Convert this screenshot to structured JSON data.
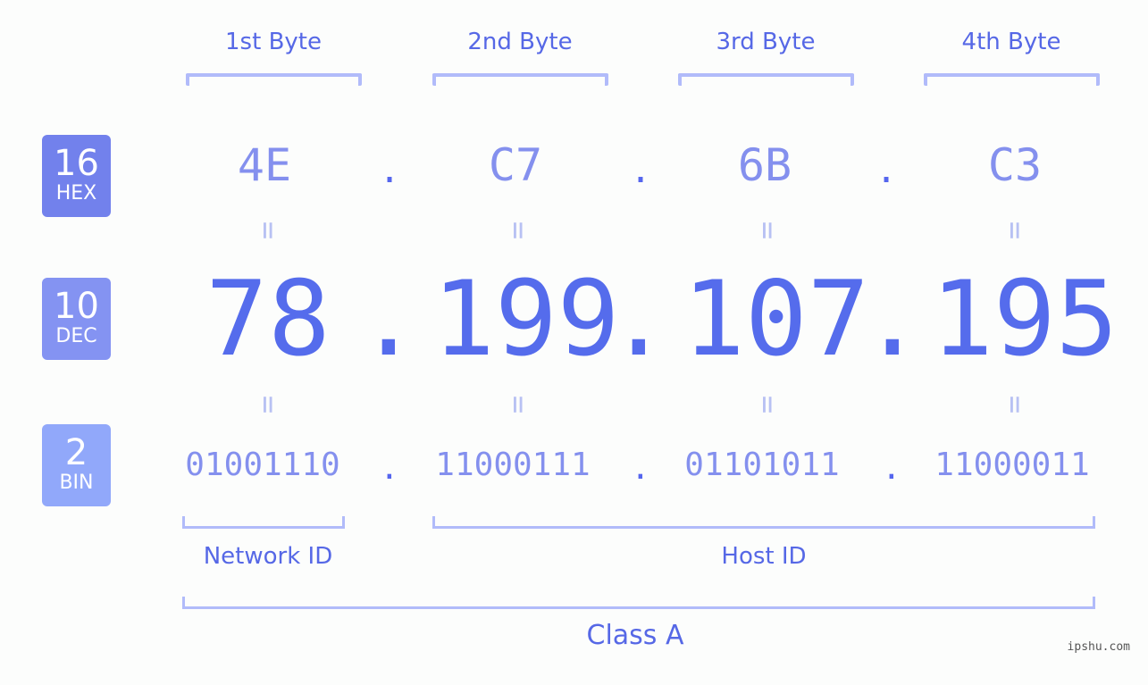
{
  "byte_headers": [
    "1st Byte",
    "2nd Byte",
    "3rd Byte",
    "4th Byte"
  ],
  "badges": {
    "hex": {
      "number": "16",
      "unit": "HEX",
      "color": "#7281ec"
    },
    "dec": {
      "number": "10",
      "unit": "DEC",
      "color": "#8493f2"
    },
    "bin": {
      "number": "2",
      "unit": "BIN",
      "color": "#91a8fa"
    }
  },
  "separator": ".",
  "equals": "=",
  "hex": [
    "4E",
    "C7",
    "6B",
    "C3"
  ],
  "dec": [
    "78",
    "199",
    "107",
    "195"
  ],
  "bin": [
    "01001110",
    "11000111",
    "01101011",
    "11000011"
  ],
  "network_id_label": "Network ID",
  "host_id_label": "Host ID",
  "class_label": "Class A",
  "watermark": "ipshu.com",
  "colors": {
    "primary_text": "#5668e6",
    "bracket": "#b1bbfa",
    "hex_bin_text": "#8490ee",
    "dec_text": "#556cec",
    "background": "#fcfdfc"
  }
}
